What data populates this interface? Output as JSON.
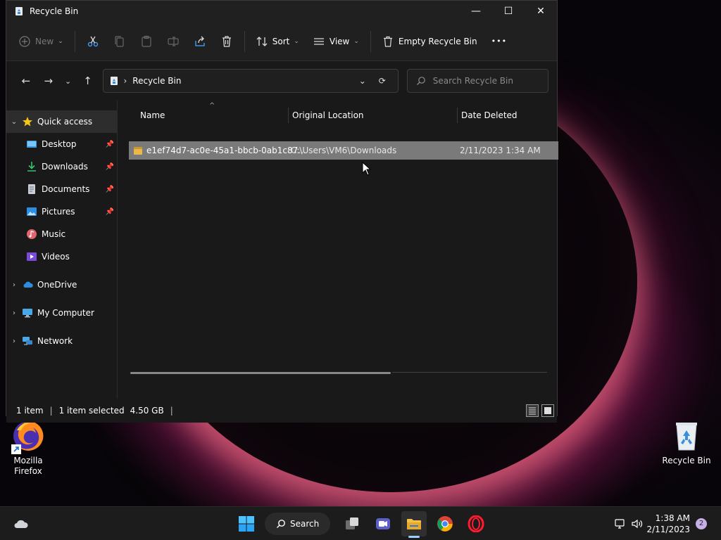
{
  "window": {
    "title": "Recycle Bin",
    "buttons": {
      "minimize": "—",
      "maximize": "☐",
      "close": "✕"
    }
  },
  "toolbar": {
    "new_label": "New",
    "sort_label": "Sort",
    "view_label": "View",
    "empty_label": "Empty Recycle Bin",
    "more_label": "•••"
  },
  "address": {
    "crumb": "Recycle Bin",
    "search_placeholder": "Search Recycle Bin"
  },
  "nav_tree": {
    "quick_access": "Quick access",
    "items": [
      {
        "label": "Desktop",
        "pinned": true
      },
      {
        "label": "Downloads",
        "pinned": true
      },
      {
        "label": "Documents",
        "pinned": true
      },
      {
        "label": "Pictures",
        "pinned": true
      },
      {
        "label": "Music",
        "pinned": false
      },
      {
        "label": "Videos",
        "pinned": false
      }
    ],
    "onedrive": "OneDrive",
    "my_computer": "My Computer",
    "network": "Network"
  },
  "columns": {
    "name": "Name",
    "original_location": "Original Location",
    "date_deleted": "Date Deleted"
  },
  "files": [
    {
      "name": "e1ef74d7-ac0e-45a1-bbcb-0ab1c87...",
      "original_location": "C:\\Users\\VM6\\Downloads",
      "date_deleted": "2/11/2023 1:34 AM"
    }
  ],
  "status": {
    "item_count": "1 item",
    "selected": "1 item selected",
    "size": "4.50 GB"
  },
  "desktop": {
    "firefox_label_1": "Mozilla",
    "firefox_label_2": "Firefox",
    "recycle_label": "Recycle Bin"
  },
  "taskbar": {
    "search_label": "Search",
    "time": "1:38 AM",
    "date": "2/11/2023",
    "notification_count": "2"
  },
  "colors": {
    "accent": "#0078d4",
    "selection": "#7a7a7a",
    "folder_yellow": "#e8b84a"
  }
}
